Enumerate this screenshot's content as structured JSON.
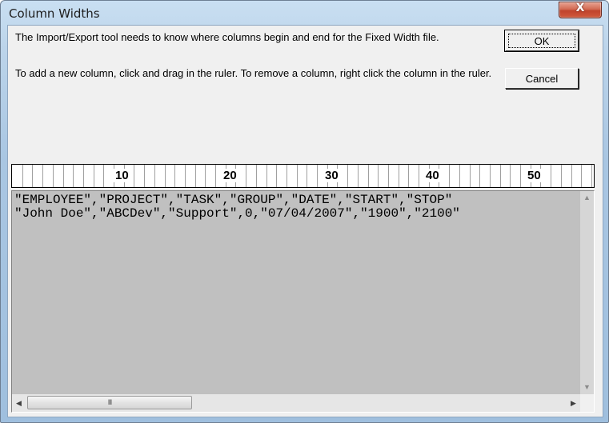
{
  "window": {
    "title": "Column Widths",
    "close_label": "X"
  },
  "messages": {
    "line1": "The Import/Export tool needs to know where columns begin and end for the Fixed Width file.",
    "line2": "To add a new column, click and drag in the ruler.  To remove a column, right click the column in the ruler."
  },
  "buttons": {
    "ok": "OK",
    "cancel": "Cancel"
  },
  "ruler": {
    "labels": [
      "10",
      "20",
      "30",
      "40",
      "50"
    ]
  },
  "preview": {
    "lines": [
      "\"EMPLOYEE\",\"PROJECT\",\"TASK\",\"GROUP\",\"DATE\",\"START\",\"STOP\"",
      "\"John Doe\",\"ABCDev\",\"Support\",0,\"07/04/2007\",\"1900\",\"2100\""
    ]
  },
  "scrollbar": {
    "thumb_grip": "III",
    "up_arrow": "▲",
    "down_arrow": "▼",
    "left_arrow": "◀",
    "right_arrow": "▶"
  }
}
